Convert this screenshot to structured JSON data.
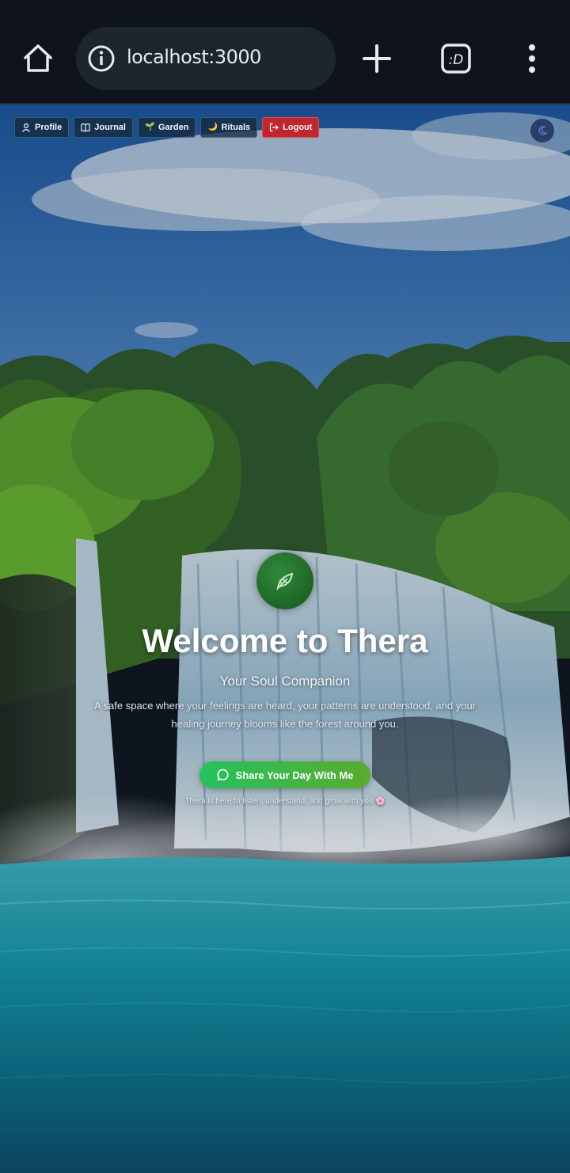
{
  "browser": {
    "url": "localhost:3000",
    "icons": [
      "home-icon",
      "info-icon",
      "new-tab-icon",
      "tab-switcher-icon",
      "more-menu-icon"
    ]
  },
  "nav": {
    "profile": "Profile",
    "journal": "Journal",
    "garden": "Garden",
    "rituals": "Rituals",
    "logout": "Logout"
  },
  "hero": {
    "title": "Welcome to Thera",
    "subtitle": "Your Soul Companion",
    "description": "A safe space where your feelings are heard, your patterns are understood, and your healing journey blooms like the forest around you.",
    "cta": "Share Your Day With Me",
    "tagline": "Thera is here to listen, understand, and grow with you 🌸"
  },
  "colors": {
    "logout": "#c0262d",
    "cta_start": "#25c260",
    "cta_end": "#5aab2d",
    "chrome_bg": "#0f141c"
  }
}
